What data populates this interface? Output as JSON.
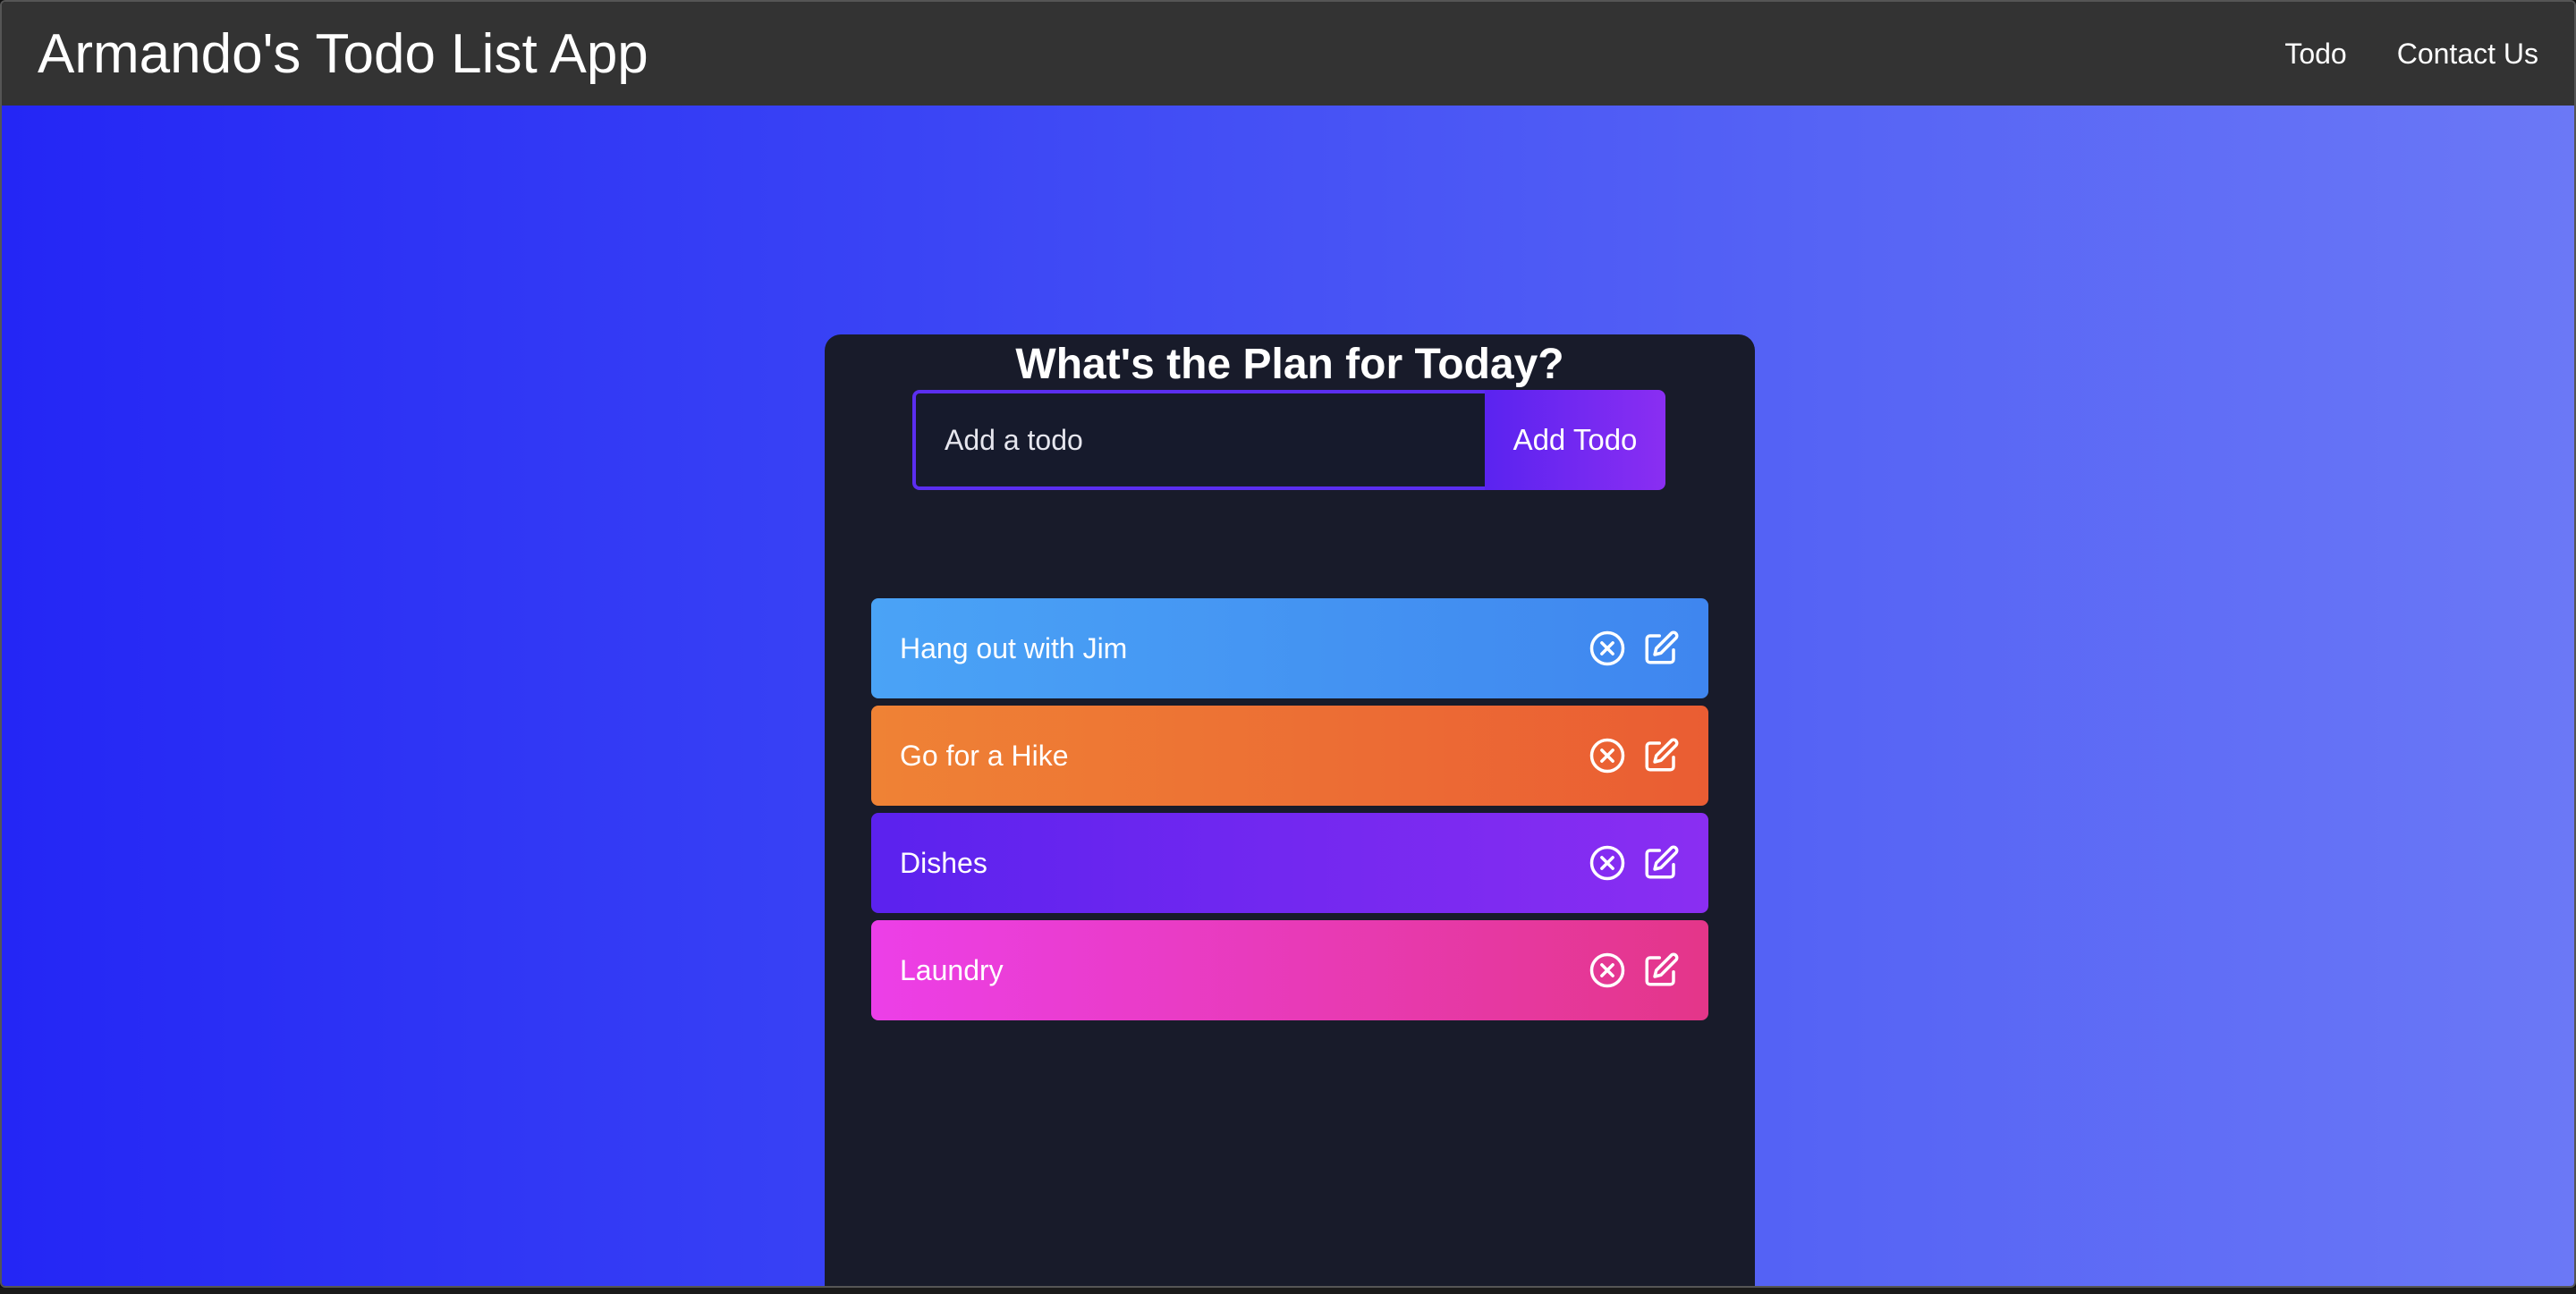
{
  "app": {
    "title": "Armando's Todo List App"
  },
  "nav": {
    "links": [
      {
        "label": "Todo"
      },
      {
        "label": "Contact Us"
      }
    ]
  },
  "card": {
    "heading": "What's the Plan for Today?",
    "input_placeholder": "Add a todo",
    "input_value": "",
    "add_button_label": "Add Todo"
  },
  "todos": [
    {
      "text": "Hang out with Jim",
      "color": "#4aa3f6"
    },
    {
      "text": "Go for a Hike",
      "color": "#ef8235"
    },
    {
      "text": "Dishes",
      "color": "#5b22ee"
    },
    {
      "text": "Laundry",
      "color": "#ec3fe8"
    }
  ],
  "icons": {
    "delete": "close-circle-icon",
    "edit": "edit-icon"
  },
  "colors": {
    "navbar": "#333333",
    "card_bg": "#181b2a",
    "gradient_start": "#2426f5",
    "gradient_end": "#6b78f6",
    "accent": "#5b2ef0"
  }
}
